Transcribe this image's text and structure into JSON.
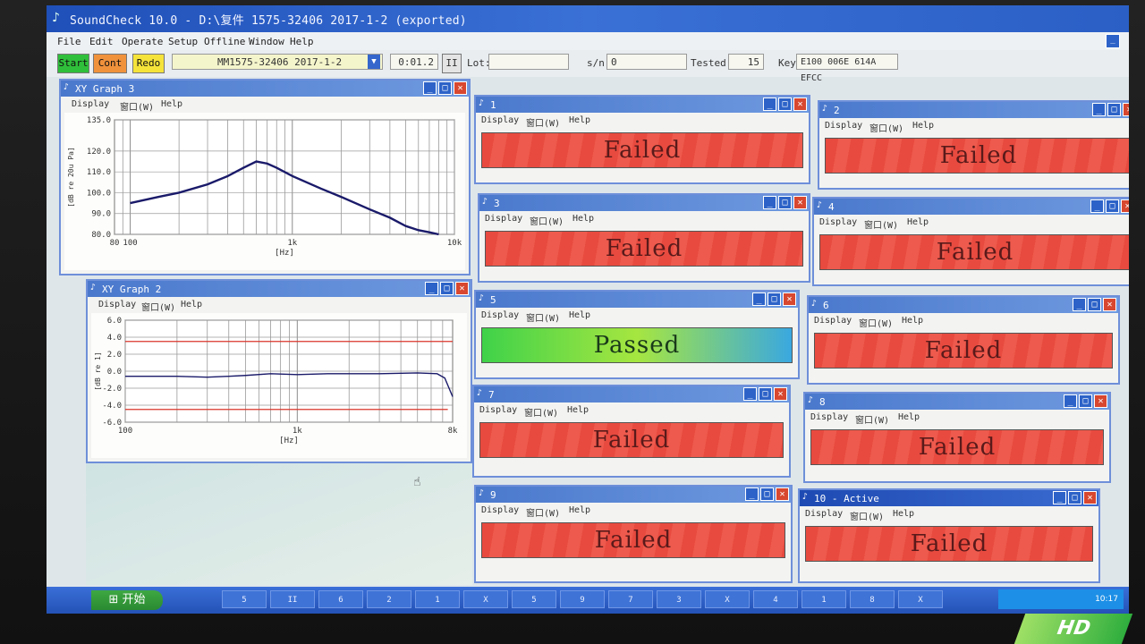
{
  "window": {
    "title": "SoundCheck 10.0 - D:\\复件 1575-32406 2017-1-2 (exported)"
  },
  "menu": [
    "File",
    "Edit",
    "Operate",
    "Setup",
    "Offline",
    "Window",
    "Help"
  ],
  "toolbar": {
    "start_label": "Start",
    "cont_label": "Cont",
    "redo_label": "Redo",
    "sequence_value": "MM1575-32406 2017-1-2",
    "time_value": "0:01.2",
    "pause_label": "II",
    "lot_label": "Lot:",
    "lot_value": "",
    "sn_label": "s/n",
    "sn_value": "0",
    "tested_label": "Tested",
    "tested_value": "15",
    "key_label": "Key",
    "key_value": "E100 006E 614A EFCC"
  },
  "graph3": {
    "title": "XY Graph 3",
    "menu": [
      "Display",
      "窗口(W)",
      "Help"
    ],
    "ylabel": "[dB re 20u Pa]",
    "xlabel": "[Hz]"
  },
  "graph2": {
    "title": "XY Graph 2",
    "menu": [
      "Display",
      "窗口(W)",
      "Help"
    ],
    "ylabel": "[dB re 1]",
    "xlabel": "[Hz]"
  },
  "chart_data": [
    {
      "type": "line",
      "name": "XY Graph 3",
      "xscale": "log",
      "xlim": [
        80,
        10000
      ],
      "ylim": [
        80,
        135
      ],
      "yticks": [
        "135.0",
        "120.0",
        "110.0",
        "100.0",
        "90.0",
        "80.0"
      ],
      "xticks": [
        "80",
        "100",
        "1k",
        "10k"
      ],
      "xlabel": "[Hz]",
      "ylabel": "[dB re 20u Pa]",
      "series": [
        {
          "x": [
            100,
            150,
            200,
            300,
            400,
            500,
            600,
            700,
            800,
            1000,
            1500,
            2000,
            3000,
            4000,
            5000,
            6000,
            7000,
            8000
          ],
          "y": [
            95,
            98,
            100,
            104,
            108,
            112,
            115,
            114,
            112,
            108,
            102,
            98,
            92,
            88,
            84,
            82,
            81,
            80
          ]
        }
      ],
      "grid": true
    },
    {
      "type": "line",
      "name": "XY Graph 2",
      "xscale": "log",
      "xlim": [
        100,
        8000
      ],
      "ylim": [
        -6,
        6
      ],
      "yticks": [
        "6.0",
        "4.0",
        "2.0",
        "0.0",
        "-2.0",
        "-4.0",
        "-6.0"
      ],
      "xticks": [
        "100",
        "1k",
        "8k"
      ],
      "xlabel": "[Hz]",
      "ylabel": "[dB re 1]",
      "series": [
        {
          "x": [
            100,
            200,
            300,
            400,
            500,
            700,
            1000,
            1500,
            2000,
            3000,
            5000,
            6500,
            7200,
            8000
          ],
          "y": [
            -0.6,
            -0.6,
            -0.7,
            -0.6,
            -0.5,
            -0.3,
            -0.4,
            -0.3,
            -0.3,
            -0.3,
            -0.2,
            -0.3,
            -0.8,
            -3.0
          ]
        },
        {
          "x": [
            100,
            8000
          ],
          "y": [
            3.5,
            3.5
          ]
        },
        {
          "x": [
            100,
            7500
          ],
          "y": [
            -4.5,
            -4.5
          ]
        }
      ],
      "grid": true
    }
  ],
  "results": [
    {
      "id": "1",
      "title": "1",
      "status": "Failed"
    },
    {
      "id": "2",
      "title": "2",
      "status": "Failed"
    },
    {
      "id": "3",
      "title": "3",
      "status": "Failed"
    },
    {
      "id": "4",
      "title": "4",
      "status": "Failed"
    },
    {
      "id": "5",
      "title": "5",
      "status": "Passed"
    },
    {
      "id": "6",
      "title": "6",
      "status": "Failed"
    },
    {
      "id": "7",
      "title": "7",
      "status": "Failed"
    },
    {
      "id": "8",
      "title": "8",
      "status": "Failed"
    },
    {
      "id": "9",
      "title": "9",
      "status": "Failed"
    },
    {
      "id": "10",
      "title": "10 - Active",
      "status": "Failed"
    }
  ],
  "result_menu": [
    "Display",
    "窗口(W)",
    "Help"
  ],
  "taskbar": {
    "start_label": "开始",
    "items": [
      "5",
      "II",
      "6",
      "2",
      "1",
      "X",
      "5",
      "9",
      "7",
      "3",
      "X",
      "4",
      "1",
      "8",
      "X"
    ],
    "clock": "10:17"
  },
  "colors": {
    "titlebar": "#2b5fc6",
    "failed": "#e84a3f",
    "passed": "#3fd24a",
    "limit": "#d9342a",
    "curve": "#1a1a6a"
  }
}
